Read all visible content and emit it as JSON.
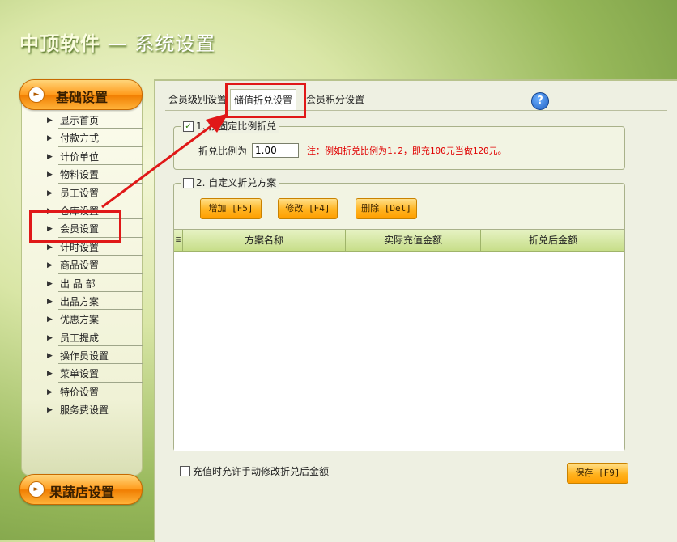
{
  "app": {
    "title_main": "中顶软件",
    "title_sub": " — 系统设置"
  },
  "sidebar": {
    "category_basic": "基础设置",
    "category_fruit": "果蔬店设置",
    "items": [
      {
        "label": "显示首页"
      },
      {
        "label": "付款方式"
      },
      {
        "label": "计价单位"
      },
      {
        "label": "物料设置"
      },
      {
        "label": "员工设置"
      },
      {
        "label": "仓库设置"
      },
      {
        "label": "会员设置"
      },
      {
        "label": "计时设置"
      },
      {
        "label": "商品设置"
      },
      {
        "label": "出 品 部"
      },
      {
        "label": "出品方案"
      },
      {
        "label": "优惠方案"
      },
      {
        "label": "员工提成"
      },
      {
        "label": "操作员设置"
      },
      {
        "label": "菜单设置"
      },
      {
        "label": "特价设置"
      },
      {
        "label": "服务费设置"
      }
    ]
  },
  "tabs": {
    "level": "会员级别设置",
    "stored": "储值折兑设置",
    "points": "会员积分设置"
  },
  "help_icon": "?",
  "ratio_group": {
    "checked": true,
    "check_mark": "✓",
    "title": "1. 按固定比例折兑",
    "label": "折兑比例为",
    "value": "1.00",
    "note": "注：例如折兑比例为1.2，即充100元当做120元。"
  },
  "custom_group": {
    "checked": false,
    "title": "2. 自定义折兑方案",
    "add_button": "增加 [F5]",
    "edit_button": "修改 [F4]",
    "delete_button": "删除 [Del]",
    "columns": {
      "indicator": "≣",
      "scheme_name": "方案名称",
      "actual_amount": "实际充值金额",
      "converted_amount": "折兑后金额"
    },
    "rows": []
  },
  "allow_manual": {
    "checked": false,
    "label": "充值时允许手动修改折兑后金额"
  },
  "save_button": "保存 [F9]",
  "colors": {
    "annotation_red": "#e01818",
    "button_orange": "#ffb31f",
    "note_red": "#e00000"
  }
}
